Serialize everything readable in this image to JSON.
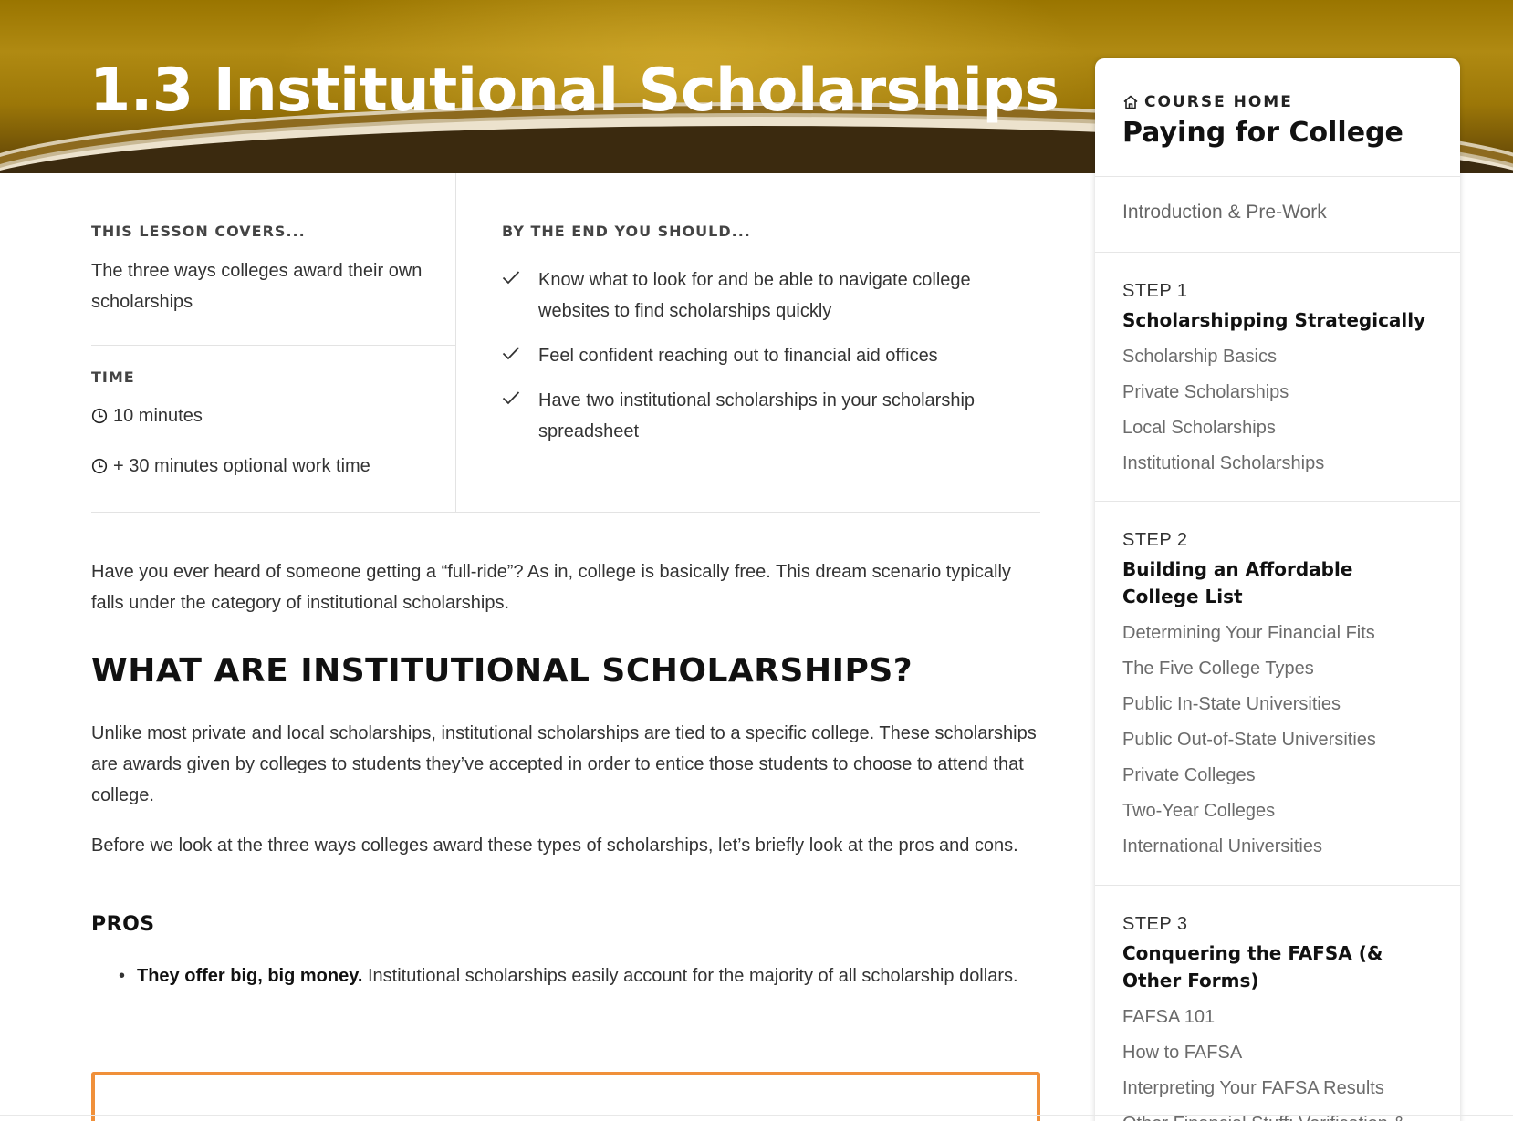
{
  "hero": {
    "title": "1.3 Institutional Scholarships"
  },
  "summary": {
    "covers_heading": "THIS LESSON COVERS...",
    "covers_text": "The three ways colleges award their own scholarships",
    "time_heading": "TIME",
    "time_items": [
      "10 minutes",
      "+ 30 minutes optional work time"
    ],
    "goals_heading": "BY THE END YOU SHOULD...",
    "goals": [
      "Know what to look for and be able to navigate college websites to find scholarships quickly",
      "Feel confident reaching out to financial aid offices",
      "Have two institutional scholarships in your scholarship spreadsheet"
    ]
  },
  "article": {
    "intro": "Have you ever heard of someone getting a “full-ride”? As in, college is basically free. This dream scenario typically falls under the category of institutional scholarships.",
    "heading": "WHAT ARE INSTITUTIONAL SCHOLARSHIPS?",
    "para1": "Unlike most private and local scholarships, institutional scholarships are tied to a specific college. These scholarships are awards given by colleges to students they’ve accepted in order to entice those students to choose to attend that college.",
    "para2": "Before we look at the three ways colleges award these types of scholarships, let’s briefly look at the pros and cons.",
    "pros_heading": "PROS",
    "pros": [
      {
        "bold": "They offer big, big money.",
        "text": " Institutional scholarships easily account for the majority of all scholarship dollars."
      }
    ]
  },
  "sidebar": {
    "course_home_label": "COURSE HOME",
    "course_title": "Paying for College",
    "intro_link": "Introduction & Pre-Work",
    "steps": [
      {
        "label": "STEP 1",
        "title": "Scholarshipping Strategically",
        "links": [
          "Scholarship Basics",
          "Private Scholarships",
          "Local Scholarships",
          "Institutional Scholarships"
        ]
      },
      {
        "label": "STEP 2",
        "title": "Building an Affordable College List",
        "links": [
          "Determining Your Financial Fits",
          "The Five College Types",
          "Public In-State Universities",
          "Public Out-of-State Universities",
          "Private Colleges",
          "Two-Year Colleges",
          "International Universities"
        ]
      },
      {
        "label": "STEP 3",
        "title": "Conquering the FAFSA (& Other Forms)",
        "links": [
          "FAFSA 101",
          "How to FAFSA",
          "Interpreting Your FAFSA Results",
          "Other Financial Stuff: Verification &"
        ]
      }
    ]
  },
  "colors": {
    "accent": "#f0903a",
    "hero_gold": "#b08a12",
    "link_gray": "#6b6b6b"
  },
  "icons": {
    "home": "home-icon",
    "clock": "clock-icon",
    "check": "check-icon"
  }
}
